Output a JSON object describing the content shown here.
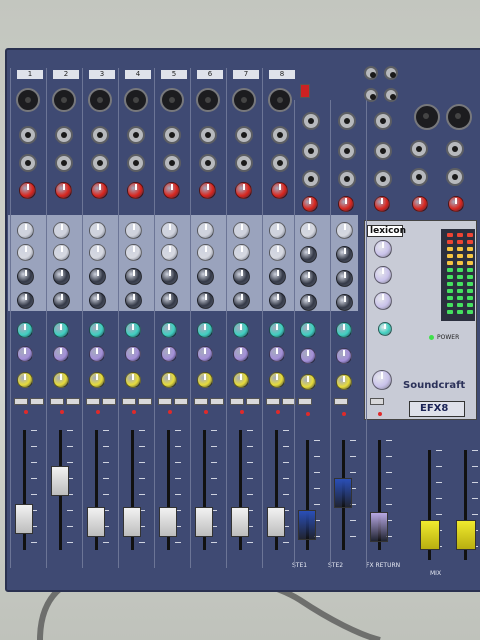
{
  "channel_numbers": [
    "1",
    "2",
    "3",
    "4",
    "5",
    "6",
    "7",
    "8"
  ],
  "master": {
    "labels": [
      "STE1",
      "STE2",
      "FX RETURN",
      "MIX"
    ]
  },
  "right_panel": {
    "lexicon_label": "lexicon",
    "brand_label": "Soundcraft",
    "model_label": "EFX8",
    "power_label": "POWER"
  },
  "fader_levels": [
    0.18,
    0.6,
    0.14,
    0.14,
    0.14,
    0.14,
    0.14,
    0.14,
    0.12,
    0.52,
    0.1,
    0.12,
    0.12
  ],
  "colors": {
    "body": "#3f4a73",
    "cyan_knob": "#3fd0c0",
    "purple_knob": "#a48fd8",
    "yellow_knob": "#e7dc3a",
    "red_knob": "#d9261e",
    "blue_cap": "#2a4fb8",
    "lavender_cap": "#b8a9e3",
    "yellow_cap": "#f0ea2e"
  }
}
